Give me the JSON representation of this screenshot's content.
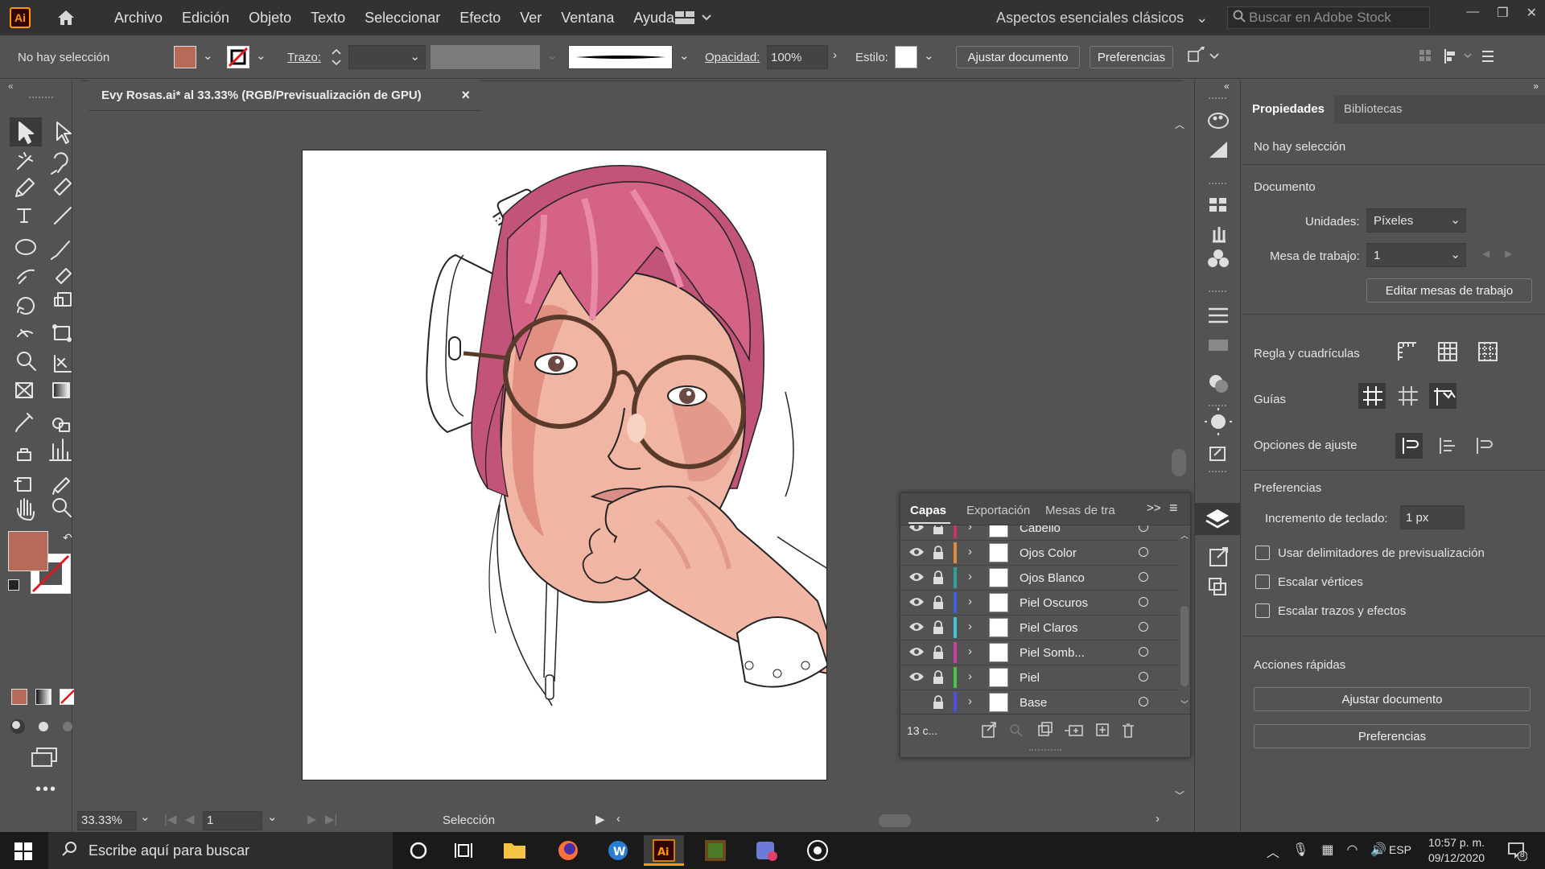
{
  "menubar": {
    "logo": "Ai",
    "items": [
      "Archivo",
      "Edición",
      "Objeto",
      "Texto",
      "Seleccionar",
      "Efecto",
      "Ver",
      "Ventana",
      "Ayuda"
    ],
    "workspace": "Aspectos esenciales clásicos",
    "stock_placeholder": "Buscar en Adobe Stock"
  },
  "control": {
    "selection": "No hay selección",
    "fill_color": "#b86a58",
    "trazo_label": "Trazo:",
    "opacidad_label": "Opacidad:",
    "opacidad_value": "100%",
    "estilo_label": "Estilo:",
    "ajustar": "Ajustar documento",
    "preferencias": "Preferencias"
  },
  "document": {
    "tab_title": "Evy Rosas.ai* al 33.33% (RGB/Previsualización de GPU)",
    "close": "×"
  },
  "status": {
    "zoom": "33.33%",
    "artboard": "1",
    "tool": "Selección"
  },
  "properties": {
    "tabs": [
      "Propiedades",
      "Bibliotecas"
    ],
    "no_selection": "No hay selección",
    "documento": "Documento",
    "unidades_label": "Unidades:",
    "unidades_value": "Píxeles",
    "mesa_label": "Mesa de trabajo:",
    "mesa_value": "1",
    "editar_mesas": "Editar mesas de trabajo",
    "regla": "Regla y cuadrículas",
    "guias": "Guías",
    "opciones_ajuste": "Opciones de ajuste",
    "preferencias_title": "Preferencias",
    "incremento_label": "Incremento de teclado:",
    "incremento_value": "1 px",
    "checkboxes": [
      "Usar delimitadores de previsualización",
      "Escalar vértices",
      "Escalar trazos y efectos"
    ],
    "acciones": "Acciones rápidas",
    "ajustar_btn": "Ajustar documento",
    "preferencias_btn": "Preferencias"
  },
  "layers": {
    "tabs": [
      "Capas",
      "Exportación",
      "Mesas de tra"
    ],
    "rows": [
      {
        "name": "Cabello",
        "color": "#cc3366",
        "visible": true
      },
      {
        "name": "Ojos Color",
        "color": "#e08a3c",
        "visible": true
      },
      {
        "name": "Ojos Blanco",
        "color": "#2aa39a",
        "visible": true
      },
      {
        "name": "Piel Oscuros",
        "color": "#3f5fe0",
        "visible": true
      },
      {
        "name": "Piel Claros",
        "color": "#42c5d6",
        "visible": true
      },
      {
        "name": "Piel Somb...",
        "color": "#cc3fa0",
        "visible": true
      },
      {
        "name": "Piel",
        "color": "#43c843",
        "visible": true
      },
      {
        "name": "Base",
        "color": "#5050e0",
        "visible": false
      }
    ],
    "count": "13 c..."
  },
  "taskbar": {
    "search_placeholder": "Escribe aquí para buscar",
    "lang": "ESP",
    "time": "10:57 p. m.",
    "date": "09/12/2020",
    "notif": "8"
  }
}
